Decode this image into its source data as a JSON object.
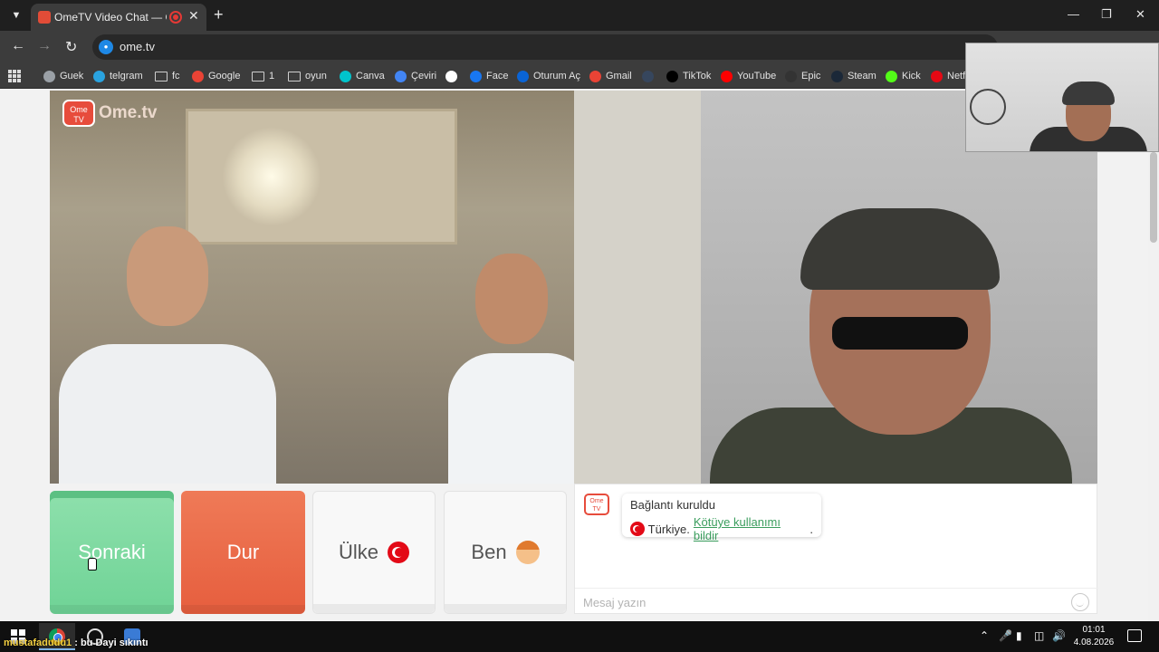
{
  "browser": {
    "tab_title": "OmeTV Video Chat — Ome",
    "url": "ome.tv",
    "bookmarks": [
      {
        "label": "Guek",
        "icon": "globe-icon",
        "color": "#9aa0a6"
      },
      {
        "label": "telgram",
        "icon": "telegram-icon",
        "color": "#2aa3e0"
      },
      {
        "label": "fc",
        "icon": "folder-icon",
        "color": ""
      },
      {
        "label": "Google",
        "icon": "google-icon",
        "color": "#ea4335"
      },
      {
        "label": "1",
        "icon": "folder-icon",
        "color": ""
      },
      {
        "label": "oyun",
        "icon": "folder-icon",
        "color": ""
      },
      {
        "label": "Canva",
        "icon": "canva-icon",
        "color": "#00c4cc"
      },
      {
        "label": "Çeviri",
        "icon": "translate-icon",
        "color": "#4285f4"
      },
      {
        "label": "",
        "icon": "x-icon",
        "color": "#ffffff"
      },
      {
        "label": "Face",
        "icon": "facebook-icon",
        "color": "#1877f2"
      },
      {
        "label": "Oturum Aç",
        "icon": "outlook-icon",
        "color": "#0a64d6"
      },
      {
        "label": "Gmail",
        "icon": "gmail-icon",
        "color": "#ea4335"
      },
      {
        "label": "",
        "icon": "tumblr-icon",
        "color": "#36465d"
      },
      {
        "label": "TikTok",
        "icon": "tiktok-icon",
        "color": "#000000"
      },
      {
        "label": "YouTube",
        "icon": "youtube-icon",
        "color": "#ff0000"
      },
      {
        "label": "Epic",
        "icon": "epic-icon",
        "color": "#333333"
      },
      {
        "label": "Steam",
        "icon": "steam-icon",
        "color": "#1b2838"
      },
      {
        "label": "Kick",
        "icon": "kick-icon",
        "color": "#53fc18"
      },
      {
        "label": "Netfl",
        "icon": "netflix-icon",
        "color": "#e50914"
      }
    ]
  },
  "ometv": {
    "logo_badge": "Ome TV",
    "logo_text": "Ome.tv",
    "buttons": {
      "next": "Sonraki",
      "stop": "Dur",
      "country": "Ülke",
      "me": "Ben"
    },
    "chat": {
      "status": "Bağlantı kuruldu",
      "country": "Türkiye.",
      "report_link": "Kötüye kullanımı bildir",
      "report_suffix": ".",
      "placeholder": "Mesaj yazın"
    }
  },
  "taskbar": {
    "overlay_user": "mustafadudu1",
    "overlay_msg": " : bu Dayi sıkıntı",
    "time": "01:01",
    "date": "4.08.2026"
  },
  "colors": {
    "next": "#75d69b",
    "stop": "#e8603f",
    "link": "#3a9d5d"
  }
}
